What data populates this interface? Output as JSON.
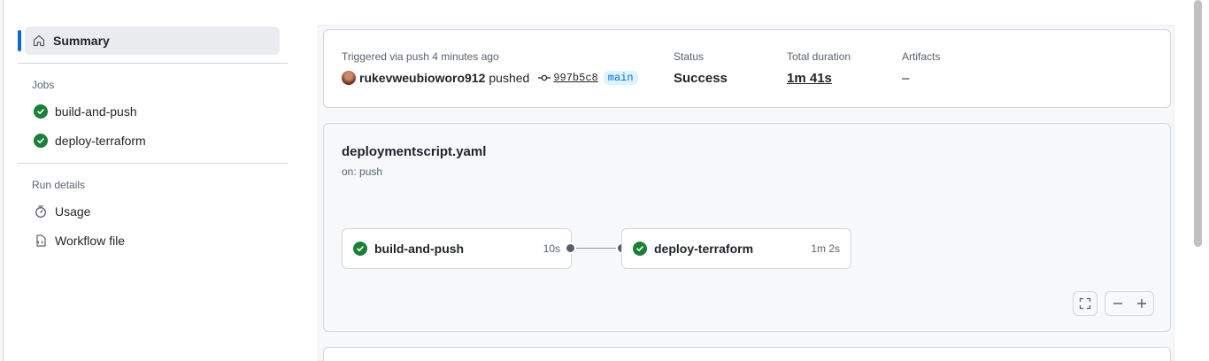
{
  "sidebar": {
    "summary_label": "Summary",
    "jobs_heading": "Jobs",
    "jobs": [
      {
        "label": "build-and-push",
        "status": "success"
      },
      {
        "label": "deploy-terraform",
        "status": "success"
      }
    ],
    "run_details_heading": "Run details",
    "details": [
      {
        "label": "Usage",
        "icon": "stopwatch-icon"
      },
      {
        "label": "Workflow file",
        "icon": "file-code-icon"
      }
    ]
  },
  "summary": {
    "trigger_text": "Triggered via push 4 minutes ago",
    "user": "rukevweubioworo912",
    "action": "pushed",
    "commit_sha": "997b5c8",
    "branch": "main",
    "status_label": "Status",
    "status_value": "Success",
    "duration_label": "Total duration",
    "duration_value": "1m 41s",
    "artifacts_label": "Artifacts",
    "artifacts_value": "–"
  },
  "workflow": {
    "file": "deploymentscript.yaml",
    "trigger": "on: push",
    "jobs": [
      {
        "name": "build-and-push",
        "duration": "10s"
      },
      {
        "name": "deploy-terraform",
        "duration": "1m 2s"
      }
    ]
  },
  "colors": {
    "accent": "#0969da",
    "success": "#1a7f37",
    "muted": "#59636e"
  }
}
